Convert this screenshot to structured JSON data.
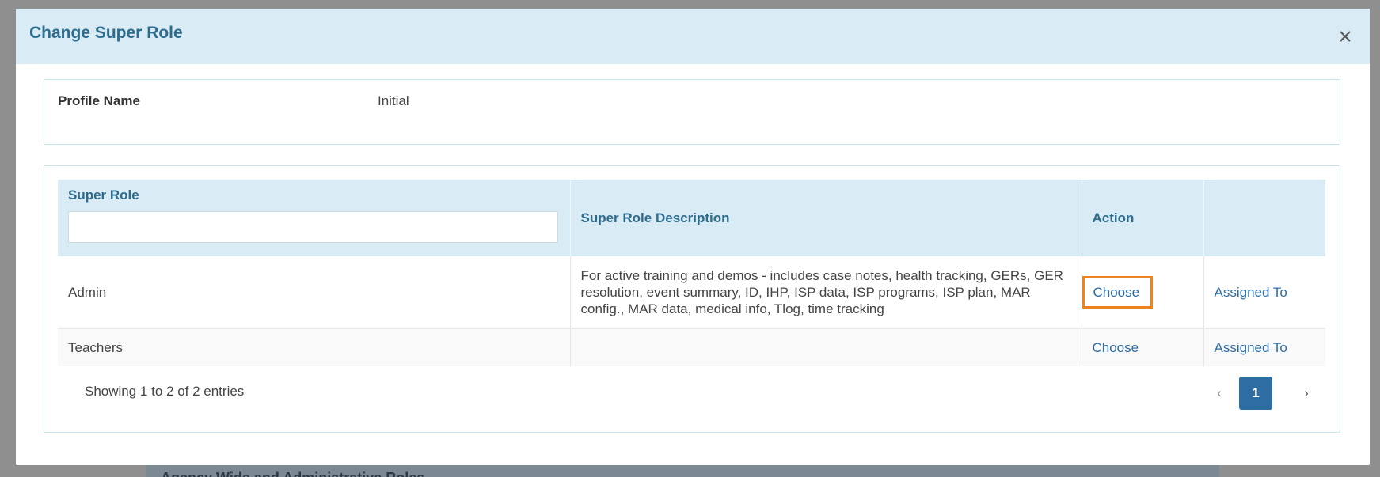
{
  "background": {
    "section_title": "Agency Wide and Administrative Roles"
  },
  "modal": {
    "title": "Change Super Role",
    "close_icon": "close-icon"
  },
  "profile": {
    "label": "Profile Name",
    "value": "Initial"
  },
  "table": {
    "columns": {
      "super_role": "Super Role",
      "description": "Super Role Description",
      "action": "Action",
      "extra": ""
    },
    "filter": {
      "value": "",
      "placeholder": ""
    },
    "rows": [
      {
        "role": "Admin",
        "description": "For active training and demos - includes case notes, health tracking, GERs, GER resolution, event summary, ID, IHP, ISP data, ISP programs, ISP plan, MAR config., MAR data, medical info, Tlog, time tracking",
        "action": "Choose",
        "assigned": "Assigned To"
      },
      {
        "role": "Teachers",
        "description": "",
        "action": "Choose",
        "assigned": "Assigned To"
      }
    ],
    "info": "Showing 1 to 2 of 2 entries"
  },
  "pagination": {
    "prev": "‹",
    "current": "1",
    "next": "›"
  },
  "colors": {
    "header_bg": "#d9ebf5",
    "title": "#2e6c8e",
    "link": "#2e6da4",
    "highlight": "#f0821e"
  }
}
